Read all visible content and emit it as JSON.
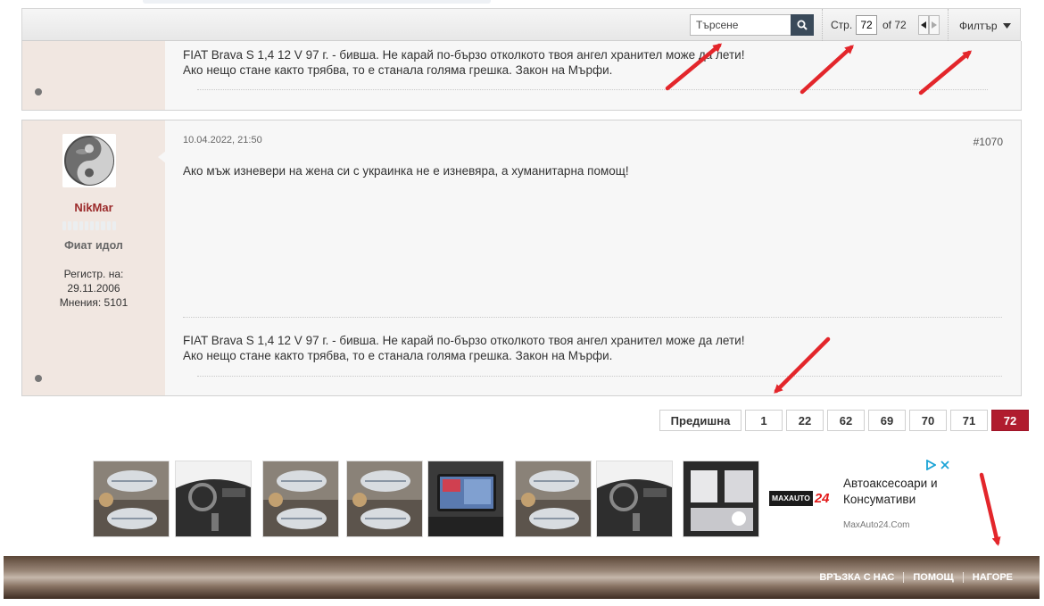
{
  "toolbar": {
    "search_placeholder": "Търсене",
    "page_label": "Стр.",
    "page_value": "72",
    "page_of": "of 72",
    "filter_label": "Филтър"
  },
  "post1": {
    "signature_line1": "FIAT Brava S 1,4 12 V 97 г. - бивша. Не карай по-бързо отколкото твоя ангел хранител може да лети!",
    "signature_line2": "Ако нещо стане както трябва, то е станала голяма грешка. Закон на Мърфи."
  },
  "post2": {
    "date": "10.04.2022, 21:50",
    "number": "#1070",
    "username": "NikMar",
    "user_title": "Фиат идол",
    "reg_label": "Регистр. на:",
    "reg_date": "29.11.2006",
    "posts_label": "Мнения: 5101",
    "message": "Ако мъж изневери на жена си с украинка не е изневяра, а хуманитарна помощ!",
    "signature_line1": "FIAT Brava S 1,4 12 V 97 г. - бивша. Не карай по-бързо отколкото твоя ангел хранител може да лети!",
    "signature_line2": "Ако нещо стане както трябва, то е станала голяма грешка. Закон на Мърфи."
  },
  "pagination": {
    "prev_label": "Предишна",
    "pages": [
      "1",
      "22",
      "62",
      "69",
      "70",
      "71",
      "72"
    ],
    "active": "72"
  },
  "ad": {
    "logo_left": "MAXAUTO",
    "logo_right": "24",
    "title_line1": "Автоаксесоари и",
    "title_line2": "Консумативи",
    "url": "MaxAuto24.Com"
  },
  "footer": {
    "contact": "ВРЪЗКА С НАС",
    "help": "ПОМОЩ",
    "top": "НАГОРЕ"
  },
  "colors": {
    "active_page": "#b01c2e",
    "username": "#9b2a2a",
    "arrow": "#e3262b"
  }
}
